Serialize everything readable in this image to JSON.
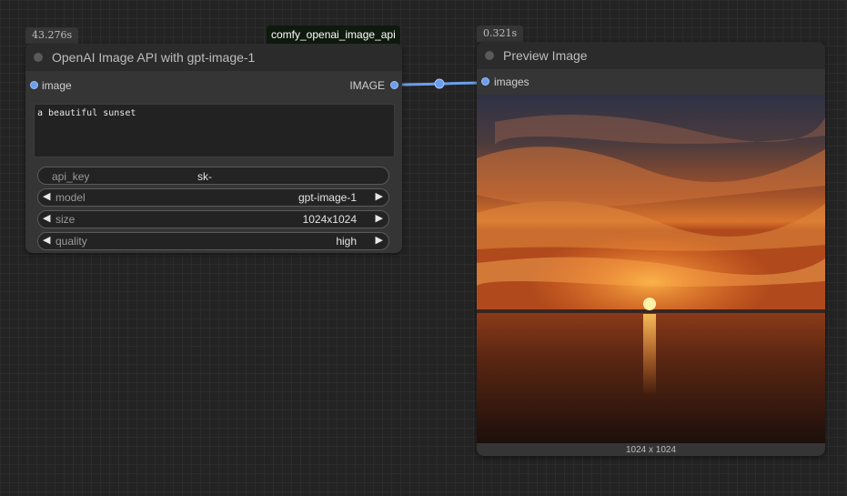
{
  "canvas": {
    "background": "#232323"
  },
  "openai_node": {
    "timing": "43.276s",
    "tag": "comfy_openai_image_api",
    "title": "OpenAI Image API with gpt-image-1",
    "input_label": "image",
    "output_label": "IMAGE",
    "prompt": "a beautiful sunset",
    "widgets": {
      "api_key": {
        "label": "api_key",
        "value": "sk-"
      },
      "model": {
        "label": "model",
        "value": "gpt-image-1"
      },
      "size": {
        "label": "size",
        "value": "1024x1024"
      },
      "quality": {
        "label": "quality",
        "value": "high"
      }
    }
  },
  "preview_node": {
    "timing": "0.321s",
    "title": "Preview Image",
    "input_label": "images",
    "dimensions": "1024 x 1024"
  },
  "colors": {
    "link": "#6c9eea",
    "node_body": "#353535",
    "node_header": "#2b2b2b"
  },
  "icons": {
    "status_dot": "circle",
    "slot": "circle",
    "decrement": "◀",
    "increment": "▶"
  }
}
